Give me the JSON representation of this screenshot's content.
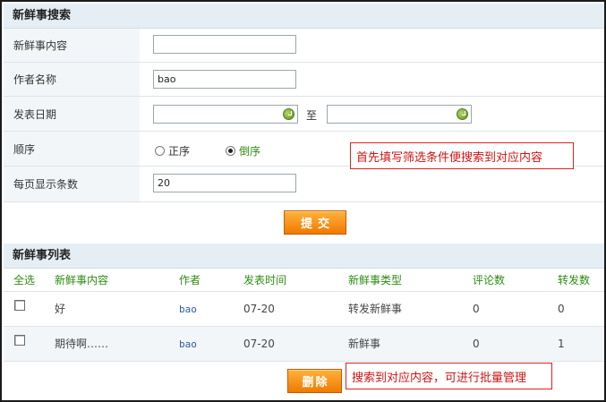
{
  "search": {
    "title": "新鲜事搜索",
    "content_label": "新鲜事内容",
    "content_value": "",
    "author_label": "作者名称",
    "author_value": "bao",
    "date_label": "发表日期",
    "date_from": "",
    "date_to": "",
    "date_separator": "至",
    "order_label": "顺序",
    "order_asc": "正序",
    "order_desc": "倒序",
    "order_selected": "倒序",
    "page_size_label": "每页显示条数",
    "page_size_value": "20",
    "submit_label": "提交"
  },
  "callouts": {
    "search_tip": "首先填写筛选条件便搜索到对应内容",
    "batch_tip": "搜索到对应内容，可进行批量管理"
  },
  "list": {
    "title": "新鲜事列表",
    "columns": [
      "全选",
      "新鲜事内容",
      "作者",
      "发表时间",
      "新鲜事类型",
      "评论数",
      "转发数"
    ],
    "rows": [
      {
        "content": "好",
        "author": "bao",
        "time": "07-20",
        "type": "转发新鲜事",
        "comments": "0",
        "forwards": "0"
      },
      {
        "content": "期待啊……",
        "author": "bao",
        "time": "07-20",
        "type": "新鲜事",
        "comments": "0",
        "forwards": "1"
      }
    ],
    "delete_label": "删除"
  },
  "colors": {
    "accent_green": "#2e8b12",
    "button_orange": "#f07a00",
    "callout_red": "#e02020",
    "header_bg": "#e6eef5"
  },
  "icons": {
    "date_picker": "calendar-check-icon"
  }
}
